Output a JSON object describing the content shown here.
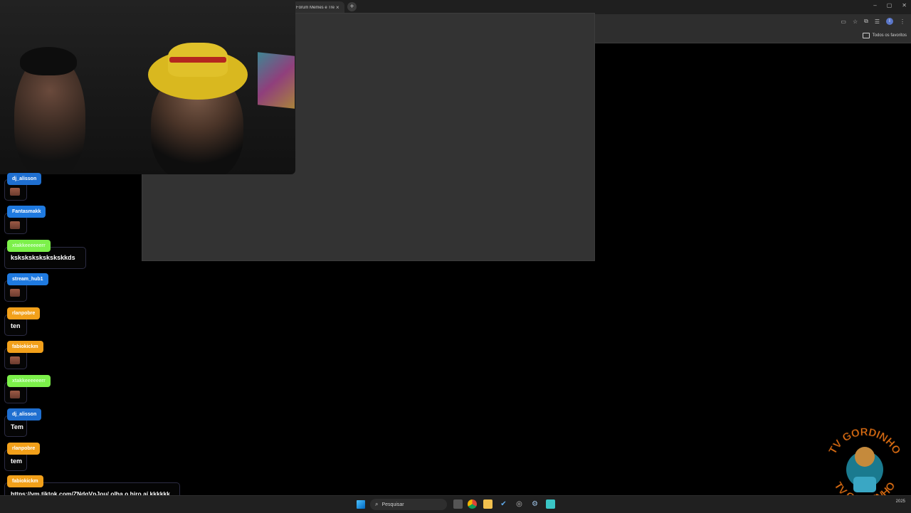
{
  "browser": {
    "tab_title": "Fórum Memes e Tre",
    "tab_close": "×",
    "new_tab": "+",
    "bookmarks_all": "Todos os favoritos",
    "profile_initial": "I",
    "window_controls": [
      "–",
      "▢",
      "✕"
    ]
  },
  "chat": {
    "messages": [
      {
        "user": "dj_alisson",
        "color": "#1f6fd0",
        "text": "",
        "emote": true
      },
      {
        "user": "Fantasmakk",
        "color": "#1f7ae0",
        "text": "",
        "emote": true
      },
      {
        "user": "xtakkeeeeeerr",
        "color": "#7cf04a",
        "text": "kskskskskskskskkds",
        "emote": false
      },
      {
        "user": "stream_hub1",
        "color": "#1f7ae0",
        "text": "",
        "emote": true
      },
      {
        "user": "rlanpobre",
        "color": "#f2a01a",
        "text": "ten",
        "emote": false
      },
      {
        "user": "fabiokickm",
        "color": "#f2a01a",
        "text": "",
        "emote": true
      },
      {
        "user": "xtakkeeeeeerr",
        "color": "#7cf04a",
        "text": "",
        "emote": true
      },
      {
        "user": "dj_alisson",
        "color": "#1f6fd0",
        "text": "Tem",
        "emote": false
      },
      {
        "user": "rlanpobre",
        "color": "#f2a01a",
        "text": "tem",
        "emote": false
      },
      {
        "user": "fabiokickm",
        "color": "#f2a01a",
        "text": "https://vm.tiktok.com/ZNdqVnJou/ olha o hiro aí kkkkkk",
        "emote": false
      }
    ]
  },
  "taskbar": {
    "search_placeholder": "Pesquisar",
    "search_icon": "search-icon",
    "tray_date": "2025"
  },
  "logo": {
    "top_text": "TV GORDINHO",
    "bottom_text": "TV GORDINHO"
  }
}
